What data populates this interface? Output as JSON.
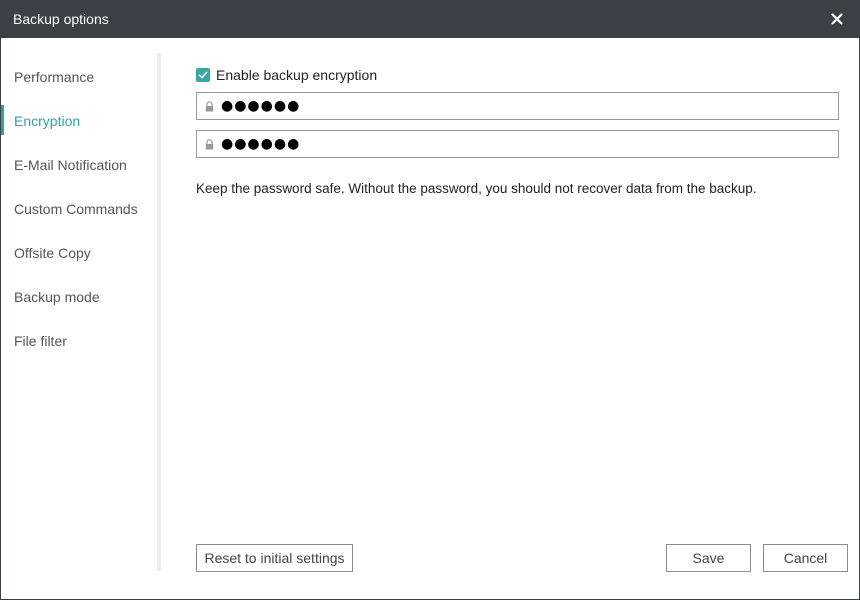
{
  "window": {
    "title": "Backup options"
  },
  "icons": {
    "close": "close-icon",
    "check": "checkmark-icon",
    "lock": "lock-icon"
  },
  "colors": {
    "titlebar": "#3b3f46",
    "accent": "#2fa3a3",
    "checkbox": "#3aa6a6"
  },
  "sidebar": {
    "active_index": 1,
    "items": [
      {
        "label": "Performance"
      },
      {
        "label": "Encryption"
      },
      {
        "label": "E-Mail Notification"
      },
      {
        "label": "Custom Commands"
      },
      {
        "label": "Offsite Copy"
      },
      {
        "label": "Backup mode"
      },
      {
        "label": "File filter"
      }
    ]
  },
  "encryption": {
    "enable_label": "Enable backup encryption",
    "enabled": true,
    "password_value": "●●●●●●",
    "confirm_value": "●●●●●●",
    "hint": "Keep the password safe. Without the password, you should not recover data from the backup."
  },
  "footer": {
    "reset_label": "Reset to initial settings",
    "save_label": "Save",
    "cancel_label": "Cancel"
  }
}
